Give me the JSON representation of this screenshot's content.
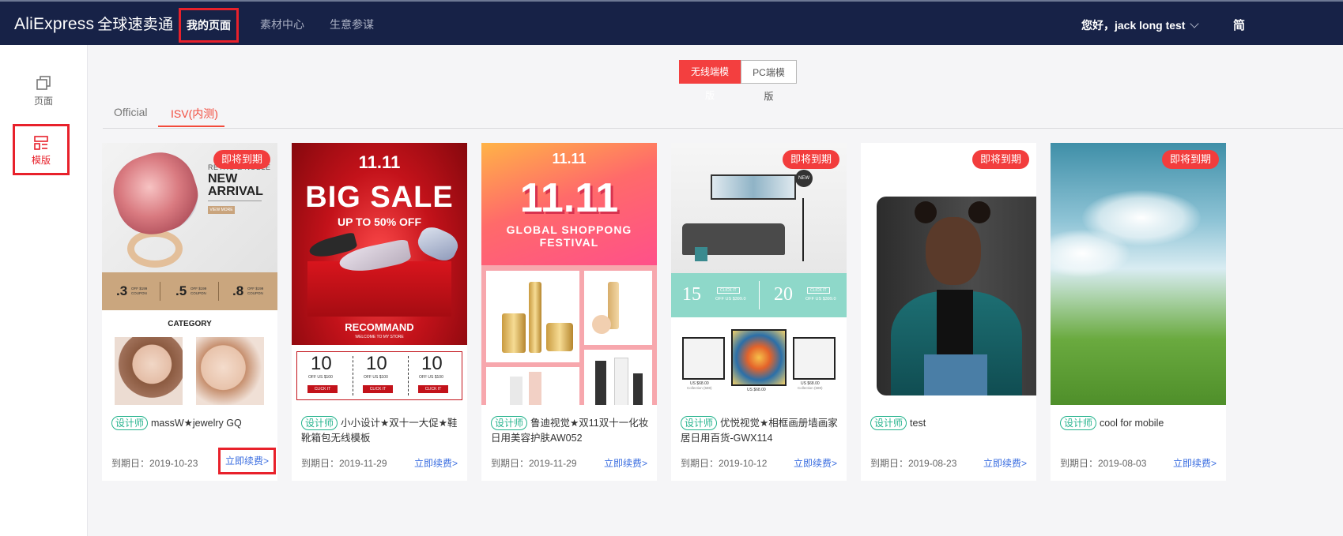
{
  "header": {
    "brand_en": "AliExpress",
    "brand_cn": "全球速卖通",
    "nav": [
      "我的页面",
      "素材中心",
      "生意参谋"
    ],
    "greeting": "您好，jack long test",
    "cut_text": "简"
  },
  "sidebar": {
    "items": [
      {
        "label": "页面",
        "icon": "pages-icon"
      },
      {
        "label": "模版",
        "icon": "template-icon"
      }
    ]
  },
  "toggle": {
    "mobile": "无线端模版",
    "pc": "PC端模版"
  },
  "tabs": [
    "Official",
    "ISV(内测)"
  ],
  "colors": {
    "accent": "#f23d3d",
    "header_bg": "#172247",
    "designer_green": "#25b38d",
    "link_blue": "#3a6de0"
  },
  "cards": [
    {
      "badge": "即将到期",
      "designer": "设计师",
      "title": "massW★jewelry GQ",
      "expiry": "到期日：2019-10-23",
      "renew": "立即续费>",
      "art": {
        "heading1": "RETRO & NOBLE",
        "heading2": "NEW",
        "heading3": "ARRIVAL",
        "btn": "VIEW MORE",
        "coupons": [
          ".3",
          ".5",
          ".8"
        ],
        "coupon_sub": "OFF $199 COUPON",
        "category": "CATEGORY"
      }
    },
    {
      "badge": "",
      "designer": "设计师",
      "title": "小小设计★双十一大促★鞋靴箱包无线模板",
      "expiry": "到期日：2019-11-29",
      "renew": "立即续费>",
      "art": {
        "logo": "11.11",
        "big": "BIG SALE",
        "sub": "UP TO 50% OFF",
        "rec": "RECOMMAND",
        "rec_sub": "WELCOME TO MY STORE",
        "coupon": "10",
        "coupon_sub": "OFF US $100",
        "click": "CLICK IT"
      }
    },
    {
      "badge": "",
      "designer": "设计师",
      "title": "鲁迪视觉★双11双十一化妆日用美容护肤AW052",
      "expiry": "到期日：2019-11-29",
      "renew": "立即续费>",
      "art": {
        "logo": "11.11",
        "big": "11.11",
        "line1": "GLOBAL SHOPPONG",
        "line2": "FESTIVAL"
      }
    },
    {
      "badge": "即将到期",
      "designer": "设计师",
      "title": "优悦视觉★相框画册墙画家居日用百货-GWX114",
      "expiry": "到期日：2019-10-12",
      "renew": "立即续费>",
      "art": {
        "new": "NEW",
        "c1": "15",
        "c2": "20",
        "click": "CLICK IT",
        "off": "OFF US $399.0",
        "price": "US $68.00",
        "coll": "Collection (588)"
      }
    },
    {
      "badge": "即将到期",
      "designer": "设计师",
      "title": "test",
      "expiry": "到期日：2019-08-23",
      "renew": "立即续费>"
    },
    {
      "badge": "即将到期",
      "designer": "设计师",
      "title": "cool for mobile",
      "expiry": "到期日：2019-08-03",
      "renew": "立即续费>"
    }
  ]
}
